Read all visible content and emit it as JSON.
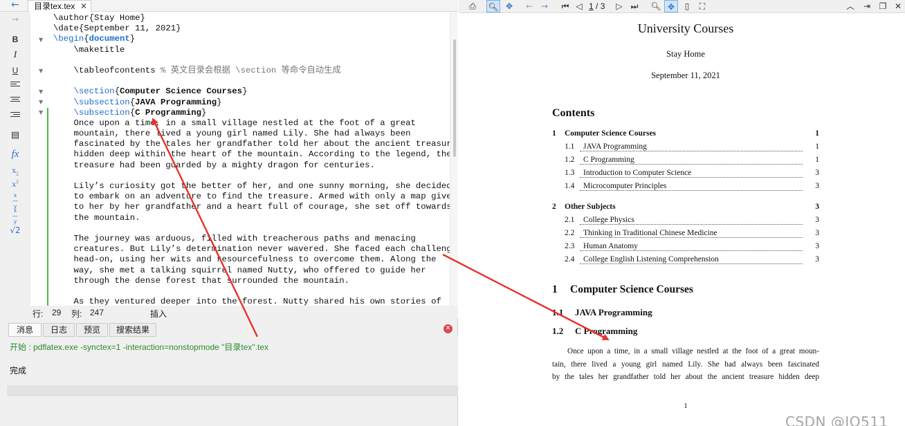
{
  "editor": {
    "tab_label": "目录tex.tex",
    "tab_close": "✕",
    "back_arrow": "←",
    "forward_arrow": "→",
    "code_lines": [
      [
        {
          "t": "\\author{Stay Home}",
          "c": ""
        }
      ],
      [
        {
          "t": "\\date{September 11, 2021}",
          "c": ""
        }
      ],
      [
        {
          "t": "\\begin",
          "c": "kw"
        },
        {
          "t": "{",
          "c": ""
        },
        {
          "t": "document",
          "c": "kw bd"
        },
        {
          "t": "}",
          "c": ""
        }
      ],
      [
        {
          "t": "    \\maketitle",
          "c": ""
        }
      ],
      [
        {
          "t": "",
          "c": ""
        }
      ],
      [
        {
          "t": "    \\tableofcontents ",
          "c": ""
        },
        {
          "t": "% 英文目录会根据 \\section 等命令自动生成",
          "c": "cm"
        }
      ],
      [
        {
          "t": "",
          "c": ""
        }
      ],
      [
        {
          "t": "    \\section",
          "c": "kw"
        },
        {
          "t": "{",
          "c": ""
        },
        {
          "t": "Computer Science Courses",
          "c": "bd"
        },
        {
          "t": "}",
          "c": ""
        }
      ],
      [
        {
          "t": "    \\subsection",
          "c": "kw"
        },
        {
          "t": "{",
          "c": ""
        },
        {
          "t": "JAVA Programming",
          "c": "bd"
        },
        {
          "t": "}",
          "c": ""
        }
      ],
      [
        {
          "t": "    \\subsection",
          "c": "kw"
        },
        {
          "t": "{",
          "c": ""
        },
        {
          "t": "C Programming",
          "c": "bd"
        },
        {
          "t": "}",
          "c": ""
        }
      ],
      [
        {
          "t": "    Once upon a time, in a small village nestled at the foot of a great",
          "c": ""
        }
      ],
      [
        {
          "t": "    mountain, there lived a young girl named Lily. She had always been",
          "c": ""
        }
      ],
      [
        {
          "t": "    fascinated by the tales her grandfather told her about the ancient treasure",
          "c": ""
        }
      ],
      [
        {
          "t": "    hidden deep within the heart of the mountain. According to the legend, the",
          "c": ""
        }
      ],
      [
        {
          "t": "    treasure had been guarded by a mighty dragon for centuries.",
          "c": ""
        }
      ],
      [
        {
          "t": "",
          "c": ""
        }
      ],
      [
        {
          "t": "    Lily’s curiosity got the better of her, and one sunny morning, she decided",
          "c": ""
        }
      ],
      [
        {
          "t": "    to embark on an adventure to find the treasure. Armed with only a map given",
          "c": ""
        }
      ],
      [
        {
          "t": "    to her by her grandfather and a heart full of courage, she set off towards",
          "c": ""
        }
      ],
      [
        {
          "t": "    the mountain.",
          "c": ""
        }
      ],
      [
        {
          "t": "",
          "c": ""
        }
      ],
      [
        {
          "t": "    The journey was arduous, filled with treacherous paths and menacing",
          "c": ""
        }
      ],
      [
        {
          "t": "    creatures. But Lily’s determination never wavered. She faced each challenge",
          "c": ""
        }
      ],
      [
        {
          "t": "    head-on, using her wits and resourcefulness to overcome them. Along the",
          "c": ""
        }
      ],
      [
        {
          "t": "    way, she met a talking squirrel named Nutty, who offered to guide her",
          "c": ""
        }
      ],
      [
        {
          "t": "    through the dense forest that surrounded the mountain.",
          "c": ""
        }
      ],
      [
        {
          "t": "",
          "c": ""
        }
      ],
      [
        {
          "t": "    As they ventured deeper into the forest. Nutty shared his own stories of",
          "c": ""
        }
      ]
    ],
    "status": {
      "line_label": "行:",
      "line_value": "29",
      "col_label": "列:",
      "col_value": "247",
      "mode": "插入"
    }
  },
  "messages": {
    "tabs": [
      "消息",
      "日志",
      "预览",
      "搜索结果"
    ],
    "command": "开始 : pdflatex.exe -synctex=1 -interaction=nonstopmode \"目录tex\".tex",
    "done": "完成"
  },
  "pdf_viewer": {
    "current_page": "1",
    "page_separator": "/",
    "total_pages": "3",
    "document": {
      "title": "University Courses",
      "author": "Stay Home",
      "date": "September 11, 2021",
      "contents_heading": "Contents",
      "toc": [
        {
          "num": "1",
          "title": "Computer Science Courses",
          "page": "1",
          "level": "section"
        },
        {
          "num": "1.1",
          "title": "JAVA Programming",
          "page": "1",
          "level": "sub"
        },
        {
          "num": "1.2",
          "title": "C Programming",
          "page": "1",
          "level": "sub"
        },
        {
          "num": "1.3",
          "title": "Introduction to Computer Science",
          "page": "3",
          "level": "sub"
        },
        {
          "num": "1.4",
          "title": "Microcomputer Principles",
          "page": "3",
          "level": "sub"
        },
        {
          "num": "2",
          "title": "Other Subjects",
          "page": "3",
          "level": "section"
        },
        {
          "num": "2.1",
          "title": "College Physics",
          "page": "3",
          "level": "sub"
        },
        {
          "num": "2.2",
          "title": "Thinking in Traditional Chinese Medicine",
          "page": "3",
          "level": "sub"
        },
        {
          "num": "2.3",
          "title": "Human Anatomy",
          "page": "3",
          "level": "sub"
        },
        {
          "num": "2.4",
          "title": "College English Listening Comprehension",
          "page": "3",
          "level": "sub"
        }
      ],
      "section_1_num": "1",
      "section_1_title": "Computer Science Courses",
      "subsection_1_1_num": "1.1",
      "subsection_1_1_title": "JAVA Programming",
      "subsection_1_2_num": "1.2",
      "subsection_1_2_title": "C Programming",
      "body_lines": [
        "Once upon a time, in a small village nestled at the foot of a great moun-",
        "tain, there lived a young girl named Lily. She had always been fascinated",
        "by the tales her grandfather told her about the ancient treasure hidden deep"
      ],
      "page_number": "1"
    }
  },
  "watermark": "CSDN @JQ511",
  "colors": {
    "keyword": "#1a6fd0",
    "comment": "#777777",
    "log_success": "#2d8a2d",
    "annotation_arrow": "#e8312a",
    "change_marker": "#44bb44"
  }
}
